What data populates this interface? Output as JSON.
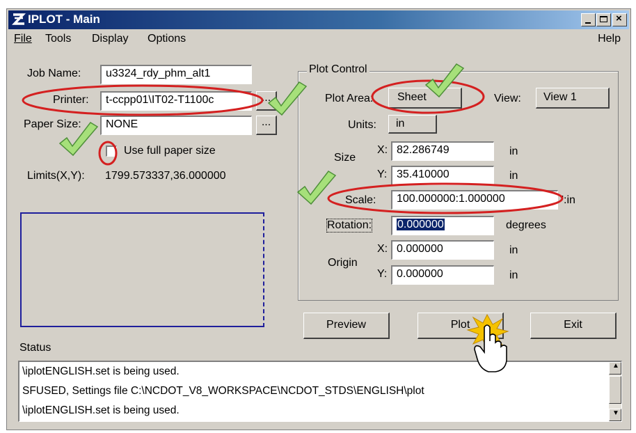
{
  "window": {
    "title": "IPLOT - Main"
  },
  "menu": {
    "file": "File",
    "tools": "Tools",
    "display": "Display",
    "options": "Options",
    "help": "Help"
  },
  "left": {
    "job_label": "Job Name:",
    "job_value": "u3324_rdy_phm_alt1",
    "printer_label": "Printer:",
    "printer_value": "t-ccpp01\\IT02-T1100c",
    "paper_label": "Paper Size:",
    "paper_value": "NONE",
    "browse_label": "...",
    "fullpaper_label": "Use full paper size",
    "fullpaper_checked": false,
    "limits_label": "Limits(X,Y):",
    "limits_value": "1799.573337,36.000000"
  },
  "plot_control": {
    "title": "Plot Control",
    "area_label": "Plot Area:",
    "area_value": "Sheet",
    "view_label": "View:",
    "view_value": "View 1",
    "units_label": "Units:",
    "units_value": "in",
    "size_label": "Size",
    "x_label": "X:",
    "y_label": "Y:",
    "size_x": "82.286749",
    "size_y": "35.410000",
    "size_unit": "in",
    "scale_label": "Scale:",
    "scale_value": "100.000000:1.000000",
    "scale_unit": "':in",
    "rotation_label": "Rotation:",
    "rotation_value": "0.000000",
    "rotation_unit": "degrees",
    "origin_label": "Origin",
    "origin_x": "0.000000",
    "origin_y": "0.000000",
    "origin_unit": "in"
  },
  "buttons": {
    "preview": "Preview",
    "plot": "Plot",
    "exit": "Exit"
  },
  "status": {
    "label": "Status",
    "lines": [
      "\\iplotENGLISH.set is being used.",
      "SFUSED, Settings file C:\\NCDOT_V8_WORKSPACE\\NCDOT_STDS\\ENGLISH\\plot",
      "\\iplotENGLISH.set is being used."
    ]
  },
  "colors": {
    "titlebar": "#0a246a",
    "annotation_red": "#d42020",
    "annotation_check": "#a6e07a"
  }
}
